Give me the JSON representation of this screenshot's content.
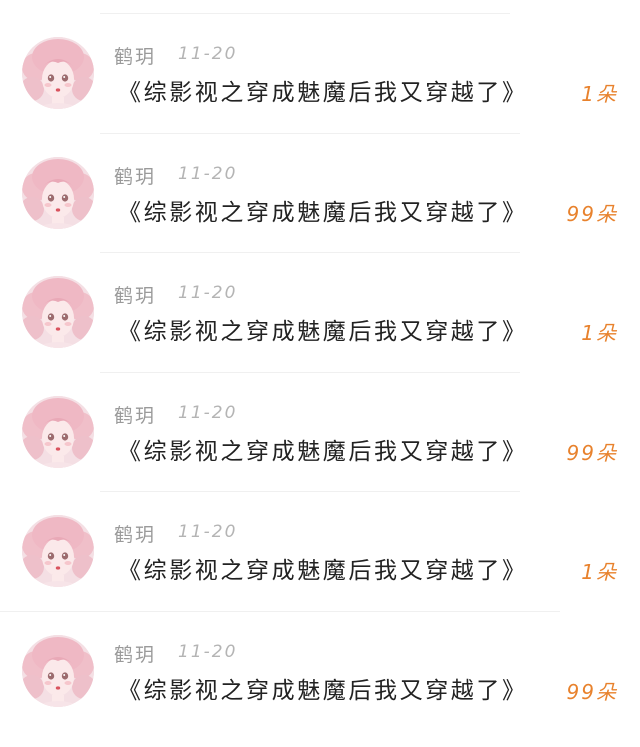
{
  "comments": [
    {
      "user": "鹤玥",
      "date": "11-20",
      "title": "《综影视之穿成魅魔后我又穿越了》",
      "flowers": "1朵",
      "avatar_icon": "pink-haired-girl-avatar"
    },
    {
      "user": "鹤玥",
      "date": "11-20",
      "title": "《综影视之穿成魅魔后我又穿越了》",
      "flowers": "99朵",
      "avatar_icon": "pink-haired-girl-avatar"
    },
    {
      "user": "鹤玥",
      "date": "11-20",
      "title": "《综影视之穿成魅魔后我又穿越了》",
      "flowers": "1朵",
      "avatar_icon": "pink-haired-girl-avatar"
    },
    {
      "user": "鹤玥",
      "date": "11-20",
      "title": "《综影视之穿成魅魔后我又穿越了》",
      "flowers": "99朵",
      "avatar_icon": "pink-haired-girl-avatar"
    },
    {
      "user": "鹤玥",
      "date": "11-20",
      "title": "《综影视之穿成魅魔后我又穿越了》",
      "flowers": "1朵",
      "avatar_icon": "pink-haired-girl-avatar"
    },
    {
      "user": "鹤玥",
      "date": "11-20",
      "title": "《综影视之穿成魅魔后我又穿越了》",
      "flowers": "99朵",
      "avatar_icon": "pink-haired-girl-avatar"
    }
  ],
  "colors": {
    "flower_count": "#e8822d",
    "username": "#9a9a9a",
    "date": "#b4b4b4",
    "title": "#222222"
  }
}
